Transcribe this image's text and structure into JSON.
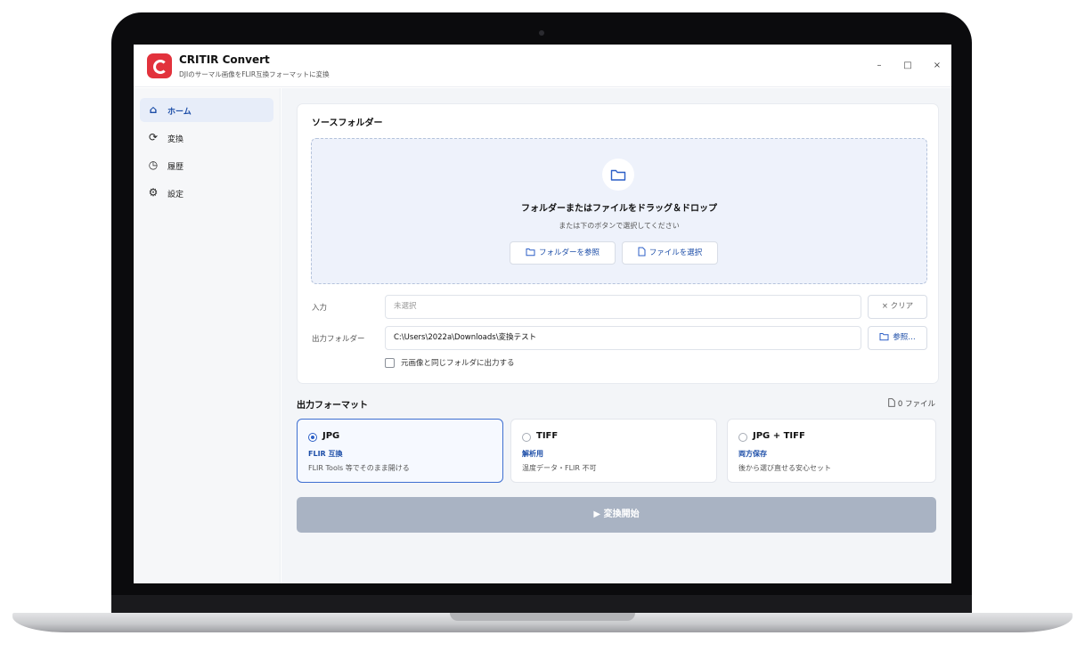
{
  "app": {
    "title": "CRITIR Convert",
    "subtitle": "DJIのサーマル画像をFLIR互換フォーマットに変換",
    "window_controls": {
      "minimize": "–",
      "maximize": "□",
      "close": "×"
    }
  },
  "sidebar": {
    "items": [
      {
        "label": "ホーム",
        "icon": "home-icon",
        "active": true
      },
      {
        "label": "変換",
        "icon": "refresh-icon",
        "active": false
      },
      {
        "label": "履歴",
        "icon": "clock-icon",
        "active": false
      },
      {
        "label": "設定",
        "icon": "gear-icon",
        "active": false
      }
    ]
  },
  "source": {
    "title": "ソースフォルダー",
    "drop_main": "フォルダーまたはファイルをドラッグ＆ドロップ",
    "drop_sub": "または下のボタンで選択してください",
    "browse_folder": "フォルダーを参照",
    "select_file": "ファイルを選択",
    "input_label": "入力",
    "input_placeholder": "未選択",
    "clear_button": "× クリア",
    "output_label": "出力フォルダー",
    "output_value": "C:\\Users\\2022a\\Downloads\\変換テスト",
    "output_browse": "参照…",
    "same_folder_label": "元画像と同じフォルダに出力する",
    "same_folder_checked": false
  },
  "format": {
    "title": "出力フォーマット",
    "file_count": "0 ファイル",
    "options": [
      {
        "name": "JPG",
        "tag": "FLIR 互換",
        "desc": "FLIR Tools 等でそのまま開ける",
        "selected": true
      },
      {
        "name": "TIFF",
        "tag": "解析用",
        "desc": "温度データ・FLIR 不可",
        "selected": false
      },
      {
        "name": "JPG + TIFF",
        "tag": "両方保存",
        "desc": "後から選び直せる安心セット",
        "selected": false
      }
    ]
  },
  "start_button": "▶  変換開始",
  "colors": {
    "accent": "#1d4ea8",
    "brand_red": "#e2323c",
    "disabled_button": "#a9b3c3"
  }
}
